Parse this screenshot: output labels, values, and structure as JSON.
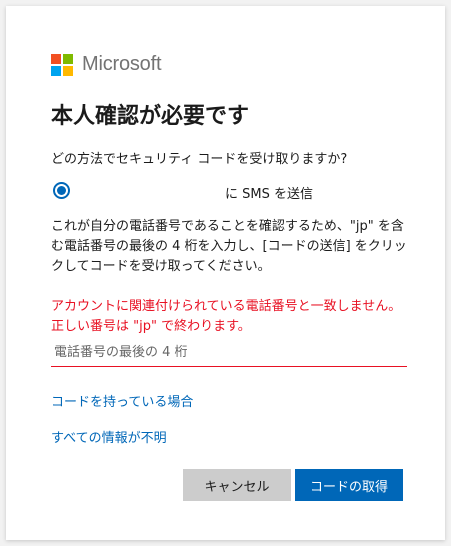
{
  "brand": {
    "name": "Microsoft",
    "logo_colors": [
      "#f25022",
      "#7fba00",
      "#00a4ef",
      "#ffb900"
    ]
  },
  "title": "本人確認が必要です",
  "prompt": "どの方法でセキュリティ コードを受け取りますか?",
  "method": {
    "label": "に SMS を送信",
    "selected": true
  },
  "description": "これが自分の電話番号であることを確認するため、\"jp\" を含む電話番号の最後の 4 桁を入力し、[コードの送信] をクリックしてコードを受け取ってください。",
  "error": "アカウントに関連付けられている電話番号と一致しません。正しい番号は \"jp\" で終わります。",
  "phone_input": {
    "placeholder": "電話番号の最後の 4 桁",
    "value": ""
  },
  "links": {
    "have_code": "コードを持っている場合",
    "info_unknown": "すべての情報が不明"
  },
  "buttons": {
    "cancel": "キャンセル",
    "get_code": "コードの取得"
  },
  "colors": {
    "accent": "#0067b8",
    "error": "#e81123",
    "secondary_button": "#cccccc"
  }
}
